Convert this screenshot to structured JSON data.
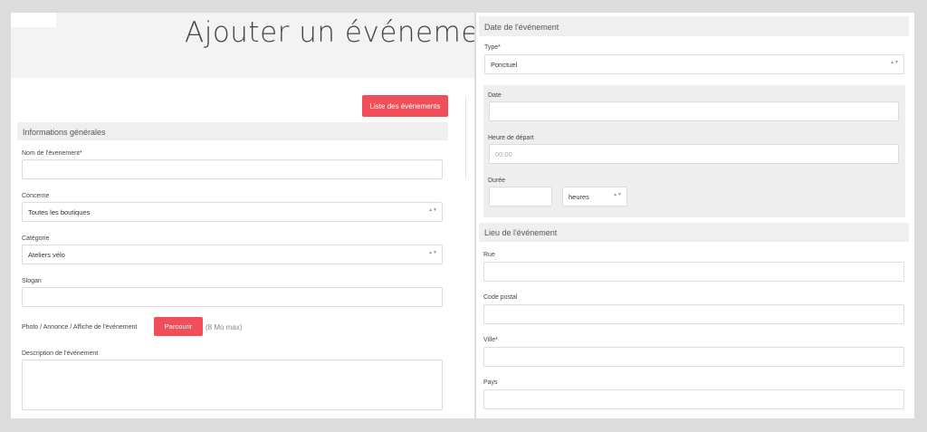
{
  "page": {
    "title": "Ajouter un événement",
    "list_button": "Liste des événements"
  },
  "general": {
    "header": "Informations générales",
    "event_name_label": "Nom de l'évenement*",
    "event_name_value": "",
    "concerne_label": "Concerne",
    "concerne_value": "Toutes les boutiques",
    "categorie_label": "Catégorie",
    "categorie_value": "Ateliers vélo",
    "slogan_label": "Slogan",
    "slogan_value": "",
    "photo_label": "Photo / Annonce / Affiche de l'événement",
    "browse_button": "Parcourir",
    "size_hint": "(8 Mo max)",
    "description_label": "Description de l'événement"
  },
  "date_section": {
    "header": "Date de l'événement",
    "type_label": "Type*",
    "type_value": "Ponctuel",
    "date_label": "Date",
    "date_value": "",
    "start_label": "Heure de départ",
    "start_placeholder": "00:00",
    "duration_label": "Durée",
    "duration_value": "",
    "duration_unit": "heures"
  },
  "place_section": {
    "header": "Lieu de l'événement",
    "street_label": "Rue",
    "postal_label": "Code postal",
    "city_label": "Ville*",
    "country_label": "Pays"
  },
  "icons": {
    "select_chevron": "▲▼"
  },
  "colors": {
    "accent": "#f04e58",
    "panel_header": "#efefef",
    "background": "#dcdcdc"
  }
}
